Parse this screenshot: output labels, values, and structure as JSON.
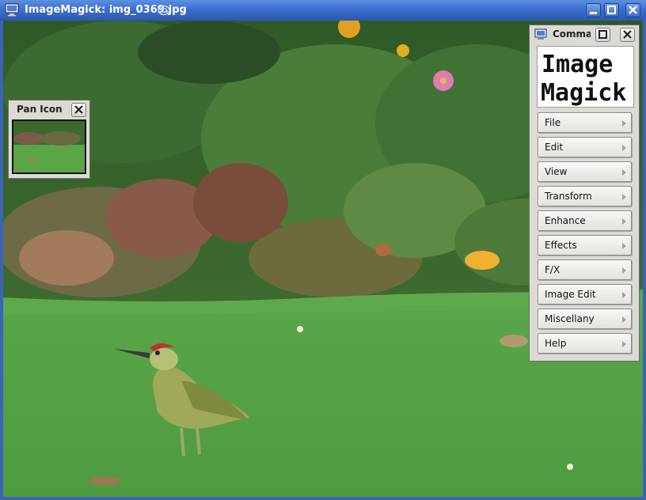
{
  "window": {
    "title": "ImageMagick: img_0369.jpg",
    "app_icon": "monitor-icon",
    "extra_icon": "swirl-icon",
    "controls": [
      "minimize-icon",
      "maximize-icon",
      "close-icon"
    ]
  },
  "pan_icon_window": {
    "title": "Pan Icon",
    "close_icon": "close-icon"
  },
  "commands_window": {
    "title": "Commands",
    "logo_text_line1": "Image",
    "logo_text_line2": "Magick",
    "menu": [
      {
        "label": "File"
      },
      {
        "label": "Edit"
      },
      {
        "label": "View"
      },
      {
        "label": "Transform"
      },
      {
        "label": "Enhance"
      },
      {
        "label": "Effects"
      },
      {
        "label": "F/X"
      },
      {
        "label": "Image Edit"
      },
      {
        "label": "Miscellany"
      },
      {
        "label": "Help"
      }
    ]
  },
  "colors": {
    "titlebar": "#3c6fcf",
    "lawn": "#5aa548",
    "panel": "#dcdad5"
  }
}
